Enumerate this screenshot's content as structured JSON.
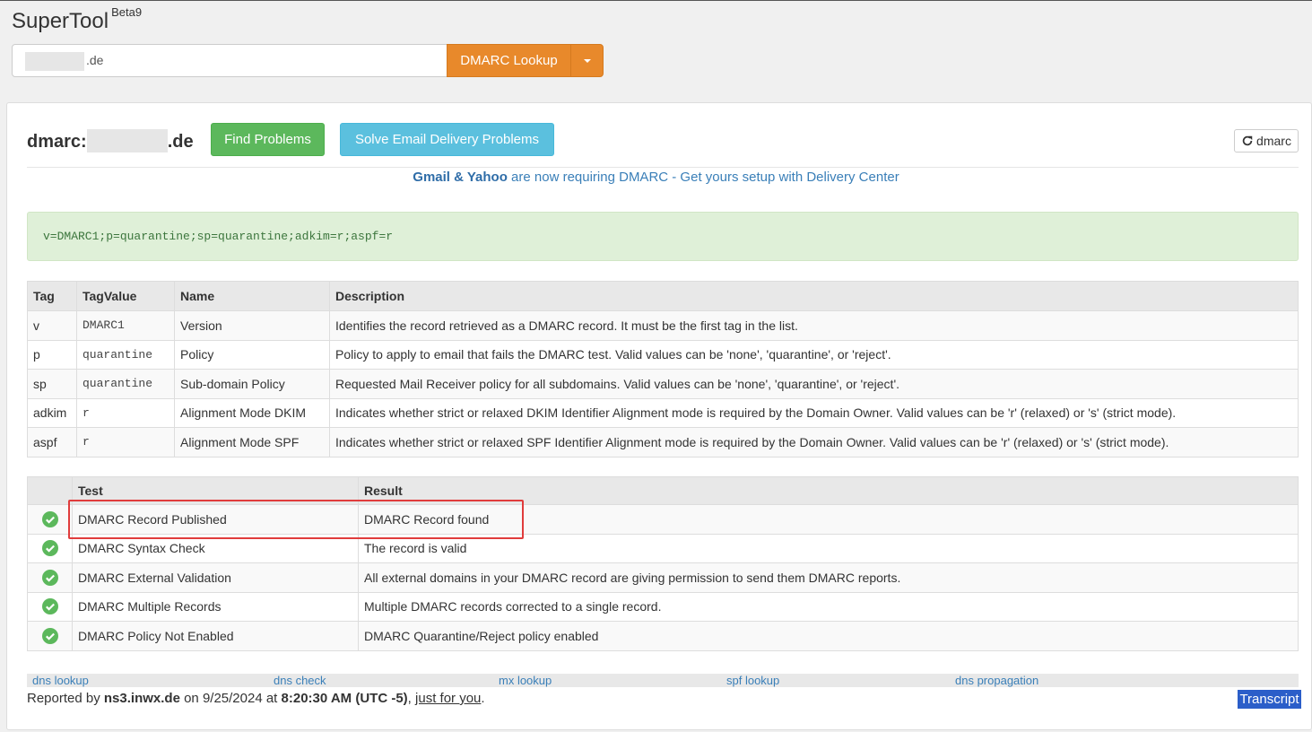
{
  "app": {
    "title": "SuperTool",
    "version": "Beta9"
  },
  "search": {
    "value": ".de",
    "button_label": "DMARC Lookup"
  },
  "page": {
    "title_prefix": "dmarc:",
    "title_suffix": ".de",
    "find_problems": "Find Problems",
    "solve_delivery": "Solve Email Delivery Problems",
    "refresh_label": "dmarc"
  },
  "promo": {
    "bold": "Gmail & Yahoo",
    "text": " are now requiring DMARC - Get yours setup with Delivery Center"
  },
  "record": "v=DMARC1;p=quarantine;sp=quarantine;adkim=r;aspf=r",
  "tag_table": {
    "headers": [
      "Tag",
      "TagValue",
      "Name",
      "Description"
    ],
    "rows": [
      [
        "v",
        "DMARC1",
        "Version",
        "Identifies the record retrieved as a DMARC record. It must be the first tag in the list."
      ],
      [
        "p",
        "quarantine",
        "Policy",
        "Policy to apply to email that fails the DMARC test. Valid values can be 'none', 'quarantine', or 'reject'."
      ],
      [
        "sp",
        "quarantine",
        "Sub-domain Policy",
        "Requested Mail Receiver policy for all subdomains. Valid values can be 'none', 'quarantine', or 'reject'."
      ],
      [
        "adkim",
        "r",
        "Alignment Mode DKIM",
        "Indicates whether strict or relaxed DKIM Identifier Alignment mode is required by the Domain Owner. Valid values can be 'r' (relaxed) or 's' (strict mode)."
      ],
      [
        "aspf",
        "r",
        "Alignment Mode SPF",
        "Indicates whether strict or relaxed SPF Identifier Alignment mode is required by the Domain Owner. Valid values can be 'r' (relaxed) or 's' (strict mode)."
      ]
    ]
  },
  "test_table": {
    "headers": [
      "",
      "Test",
      "Result"
    ],
    "rows": [
      [
        "DMARC Record Published",
        "DMARC Record found"
      ],
      [
        "DMARC Syntax Check",
        "The record is valid"
      ],
      [
        "DMARC External Validation",
        "All external domains in your DMARC record are giving permission to send them DMARC reports."
      ],
      [
        "DMARC Multiple Records",
        "Multiple DMARC records corrected to a single record."
      ],
      [
        "DMARC Policy Not Enabled",
        "DMARC Quarantine/Reject policy enabled"
      ]
    ],
    "status_color": "#5cb85c"
  },
  "links": [
    "dns lookup",
    "dns check",
    "mx lookup",
    "spf lookup",
    "dns propagation"
  ],
  "footer": {
    "reported_by": "Reported by ",
    "server": "ns3.inwx.de",
    "on": " on 9/25/2024 at ",
    "time": "8:20:30 AM (UTC -5)",
    "sep": ", ",
    "just_for_you": "just for you",
    "end": ".",
    "transcript": "Transcript"
  }
}
